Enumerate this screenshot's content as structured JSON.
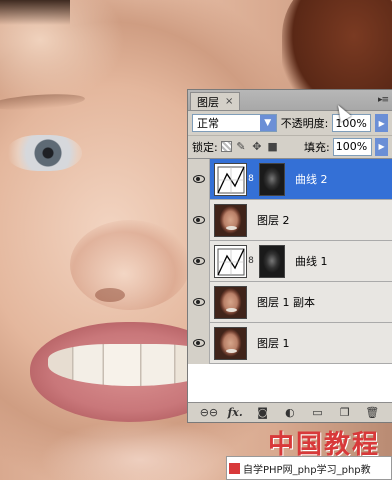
{
  "panel": {
    "tab_label": "图层",
    "tab_close": "×",
    "menu_icon": "panel-menu-icon",
    "blend_mode": "正常",
    "opacity_label": "不透明度:",
    "opacity_value": "100%",
    "lock_label": "锁定:",
    "fill_label": "填充:",
    "fill_value": "100%",
    "layers": [
      {
        "name": "曲线 2",
        "type": "curves",
        "has_mask": true,
        "selected": true
      },
      {
        "name": "图层 2",
        "type": "image",
        "has_mask": false,
        "selected": false
      },
      {
        "name": "曲线 1",
        "type": "curves",
        "has_mask": true,
        "selected": false
      },
      {
        "name": "图层 1 副本",
        "type": "image",
        "has_mask": false,
        "selected": false
      },
      {
        "name": "图层 1",
        "type": "image",
        "has_mask": false,
        "selected": false
      }
    ],
    "footer_icons": [
      "link-icon",
      "fx-icon",
      "mask-icon",
      "adjustment-icon",
      "group-folder-icon",
      "new-layer-icon",
      "trash-icon"
    ],
    "footer_fx": "fx."
  },
  "watermark": {
    "big": "中国教程网",
    "bar": "自学PHP网_php学习_php教"
  },
  "colors": {
    "selected_row": "#3470d6",
    "panel_bg": "#d4d0c8",
    "watermark_red": "#d8393a"
  }
}
